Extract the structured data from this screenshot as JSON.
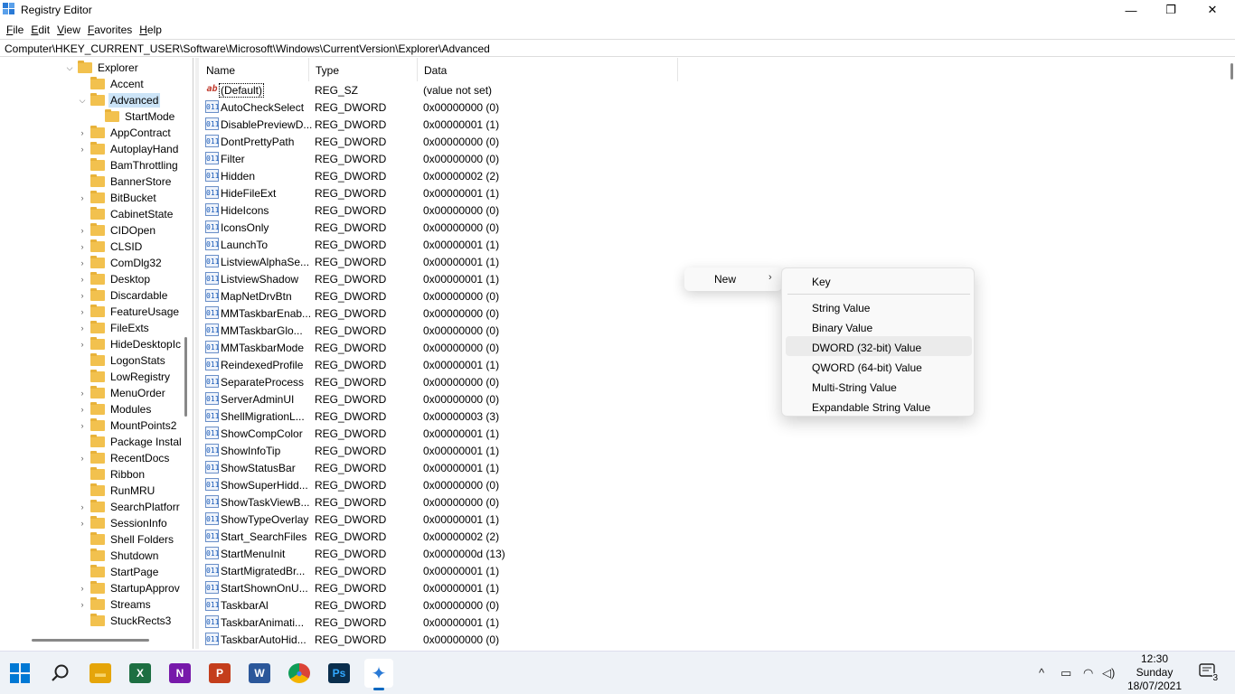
{
  "window": {
    "title": "Registry Editor",
    "min": "—",
    "max": "❐",
    "close": "✕"
  },
  "menu": [
    {
      "u": "F",
      "rest": "ile"
    },
    {
      "u": "E",
      "rest": "dit"
    },
    {
      "u": "V",
      "rest": "iew"
    },
    {
      "u": "F",
      "rest": "avorites"
    },
    {
      "u": "H",
      "rest": "elp"
    }
  ],
  "address": "Computer\\HKEY_CURRENT_USER\\Software\\Microsoft\\Windows\\CurrentVersion\\Explorer\\Advanced",
  "tree": {
    "explorer": "Explorer",
    "accent": "Accent",
    "advanced": "Advanced",
    "startmode": "StartMode",
    "children": [
      "AppContract",
      "AutoplayHand",
      "BamThrottling",
      "BannerStore",
      "BitBucket",
      "CabinetState",
      "CIDOpen",
      "CLSID",
      "ComDlg32",
      "Desktop",
      "Discardable",
      "FeatureUsage",
      "FileExts",
      "HideDesktopIc",
      "LogonStats",
      "LowRegistry",
      "MenuOrder",
      "Modules",
      "MountPoints2",
      "Package Instal",
      "RecentDocs",
      "Ribbon",
      "RunMRU",
      "SearchPlatforr",
      "SessionInfo",
      "Shell Folders",
      "Shutdown",
      "StartPage",
      "StartupApprov",
      "Streams",
      "StuckRects3"
    ]
  },
  "columns": {
    "name": "Name",
    "type": "Type",
    "data": "Data"
  },
  "rows": [
    {
      "name": "(Default)",
      "type": "REG_SZ",
      "data": "(value not set)",
      "icon": "ab"
    },
    {
      "name": "AutoCheckSelect",
      "type": "REG_DWORD",
      "data": "0x00000000 (0)",
      "icon": "011"
    },
    {
      "name": "DisablePreviewD...",
      "type": "REG_DWORD",
      "data": "0x00000001 (1)",
      "icon": "011"
    },
    {
      "name": "DontPrettyPath",
      "type": "REG_DWORD",
      "data": "0x00000000 (0)",
      "icon": "011"
    },
    {
      "name": "Filter",
      "type": "REG_DWORD",
      "data": "0x00000000 (0)",
      "icon": "011"
    },
    {
      "name": "Hidden",
      "type": "REG_DWORD",
      "data": "0x00000002 (2)",
      "icon": "011"
    },
    {
      "name": "HideFileExt",
      "type": "REG_DWORD",
      "data": "0x00000001 (1)",
      "icon": "011"
    },
    {
      "name": "HideIcons",
      "type": "REG_DWORD",
      "data": "0x00000000 (0)",
      "icon": "011"
    },
    {
      "name": "IconsOnly",
      "type": "REG_DWORD",
      "data": "0x00000000 (0)",
      "icon": "011"
    },
    {
      "name": "LaunchTo",
      "type": "REG_DWORD",
      "data": "0x00000001 (1)",
      "icon": "011"
    },
    {
      "name": "ListviewAlphaSe...",
      "type": "REG_DWORD",
      "data": "0x00000001 (1)",
      "icon": "011"
    },
    {
      "name": "ListviewShadow",
      "type": "REG_DWORD",
      "data": "0x00000001 (1)",
      "icon": "011"
    },
    {
      "name": "MapNetDrvBtn",
      "type": "REG_DWORD",
      "data": "0x00000000 (0)",
      "icon": "011"
    },
    {
      "name": "MMTaskbarEnab...",
      "type": "REG_DWORD",
      "data": "0x00000000 (0)",
      "icon": "011"
    },
    {
      "name": "MMTaskbarGlo...",
      "type": "REG_DWORD",
      "data": "0x00000000 (0)",
      "icon": "011"
    },
    {
      "name": "MMTaskbarMode",
      "type": "REG_DWORD",
      "data": "0x00000000 (0)",
      "icon": "011"
    },
    {
      "name": "ReindexedProfile",
      "type": "REG_DWORD",
      "data": "0x00000001 (1)",
      "icon": "011"
    },
    {
      "name": "SeparateProcess",
      "type": "REG_DWORD",
      "data": "0x00000000 (0)",
      "icon": "011"
    },
    {
      "name": "ServerAdminUI",
      "type": "REG_DWORD",
      "data": "0x00000000 (0)",
      "icon": "011"
    },
    {
      "name": "ShellMigrationL...",
      "type": "REG_DWORD",
      "data": "0x00000003 (3)",
      "icon": "011"
    },
    {
      "name": "ShowCompColor",
      "type": "REG_DWORD",
      "data": "0x00000001 (1)",
      "icon": "011"
    },
    {
      "name": "ShowInfoTip",
      "type": "REG_DWORD",
      "data": "0x00000001 (1)",
      "icon": "011"
    },
    {
      "name": "ShowStatusBar",
      "type": "REG_DWORD",
      "data": "0x00000001 (1)",
      "icon": "011"
    },
    {
      "name": "ShowSuperHidd...",
      "type": "REG_DWORD",
      "data": "0x00000000 (0)",
      "icon": "011"
    },
    {
      "name": "ShowTaskViewB...",
      "type": "REG_DWORD",
      "data": "0x00000000 (0)",
      "icon": "011"
    },
    {
      "name": "ShowTypeOverlay",
      "type": "REG_DWORD",
      "data": "0x00000001 (1)",
      "icon": "011"
    },
    {
      "name": "Start_SearchFiles",
      "type": "REG_DWORD",
      "data": "0x00000002 (2)",
      "icon": "011"
    },
    {
      "name": "StartMenuInit",
      "type": "REG_DWORD",
      "data": "0x0000000d (13)",
      "icon": "011"
    },
    {
      "name": "StartMigratedBr...",
      "type": "REG_DWORD",
      "data": "0x00000001 (1)",
      "icon": "011"
    },
    {
      "name": "StartShownOnU...",
      "type": "REG_DWORD",
      "data": "0x00000001 (1)",
      "icon": "011"
    },
    {
      "name": "TaskbarAl",
      "type": "REG_DWORD",
      "data": "0x00000000 (0)",
      "icon": "011"
    },
    {
      "name": "TaskbarAnimati...",
      "type": "REG_DWORD",
      "data": "0x00000001 (1)",
      "icon": "011"
    },
    {
      "name": "TaskbarAutoHid...",
      "type": "REG_DWORD",
      "data": "0x00000000 (0)",
      "icon": "011"
    }
  ],
  "context_menu": {
    "new": "New",
    "arrow": "›"
  },
  "submenu": {
    "key": "Key",
    "items": [
      "String Value",
      "Binary Value",
      "DWORD (32-bit) Value",
      "QWORD (64-bit) Value",
      "Multi-String Value",
      "Expandable String Value"
    ]
  },
  "taskbar": {
    "apps": [
      {
        "name": "file-explorer",
        "glyph": "▬",
        "color": "#f2b01e"
      },
      {
        "name": "excel",
        "glyph": "X",
        "color": "#1d6f42"
      },
      {
        "name": "onenote",
        "glyph": "N",
        "color": "#7719aa"
      },
      {
        "name": "powerpoint",
        "glyph": "P",
        "color": "#c43e1c"
      },
      {
        "name": "word",
        "glyph": "W",
        "color": "#2b579a"
      },
      {
        "name": "chrome",
        "glyph": "●",
        "color": "#db4437"
      },
      {
        "name": "photoshop",
        "glyph": "Ps",
        "color": "#0a2e4d"
      },
      {
        "name": "regedit",
        "glyph": "✦",
        "color": "#2a7ad6"
      }
    ],
    "time": "12:30",
    "day": "Sunday",
    "date": "18/07/2021",
    "notifications": "3",
    "tray": {
      "chevron": "^",
      "battery": "▭",
      "wifi": "◠",
      "volume": "◁)"
    }
  }
}
